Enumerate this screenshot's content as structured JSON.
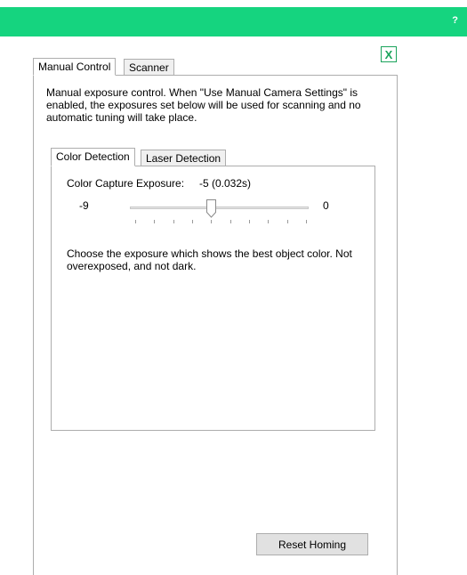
{
  "window": {
    "help_label": "?",
    "close_label": "X",
    "accent_color": "#15d47f"
  },
  "tabs": {
    "outer": [
      "Manual Control",
      "Scanner"
    ],
    "inner": [
      "Color Detection",
      "Laser Detection"
    ]
  },
  "manual_control": {
    "intro": "Manual exposure control. When \"Use Manual Camera Settings\" is enabled, the exposures set below will be used for scanning and no automatic tuning will take place.",
    "color_detection": {
      "exposure_label": "Color Capture Exposure:",
      "exposure_value": "-5 (0.032s)",
      "slider": {
        "min_label": "-9",
        "max_label": "0",
        "min": -9,
        "max": 0,
        "value": -5
      },
      "help": "Choose the exposure which shows the best object color. Not overexposed, and not dark."
    },
    "reset_button": "Reset Homing"
  }
}
